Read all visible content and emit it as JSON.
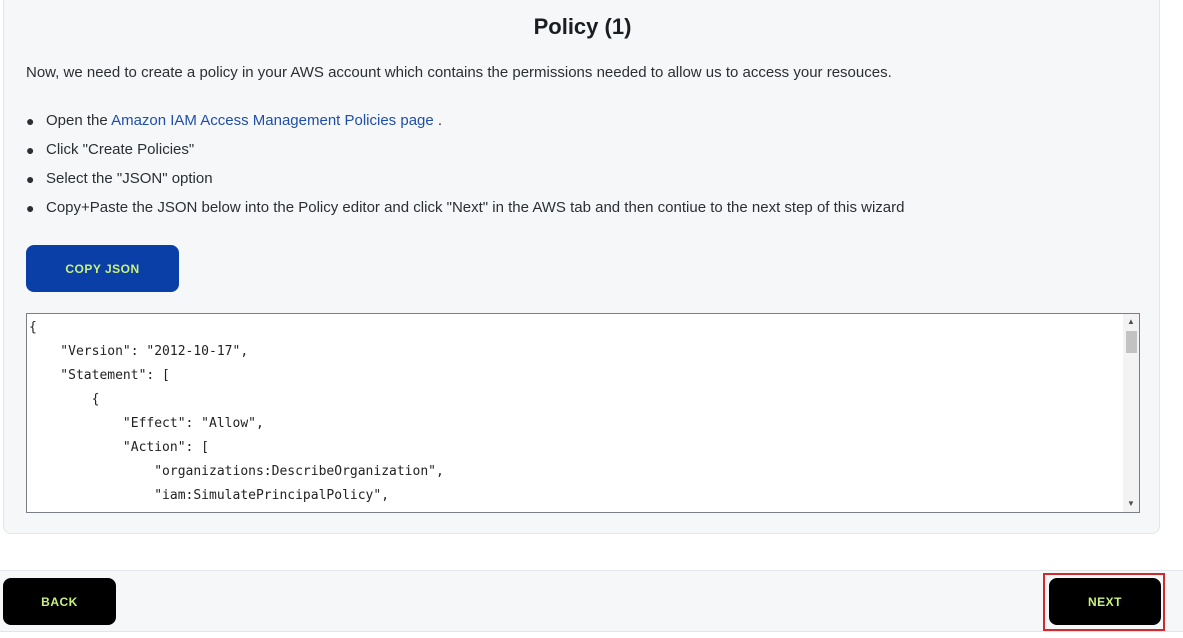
{
  "page": {
    "title": "Policy (1)",
    "intro": "Now, we need to create a policy in your AWS account which contains the permissions needed to allow us to access your resouces."
  },
  "steps": [
    {
      "prefix": "Open the ",
      "link": "Amazon IAM Access Management Policies page",
      "suffix": " ."
    },
    {
      "text": "Click \"Create Policies\""
    },
    {
      "text": "Select the \"JSON\" option"
    },
    {
      "text": "Copy+Paste the JSON below into the Policy editor and click \"Next\" in the AWS tab and then contiue to the next step of this wizard"
    }
  ],
  "copy_button": {
    "label": "COPY JSON"
  },
  "json_editor": {
    "lines": [
      "{",
      "    \"Version\": \"2012-10-17\",",
      "    \"Statement\": [",
      "        {",
      "            \"Effect\": \"Allow\",",
      "            \"Action\": [",
      "                \"organizations:DescribeOrganization\",",
      "                \"iam:SimulatePrincipalPolicy\","
    ]
  },
  "footer": {
    "back_label": "BACK",
    "next_label": "NEXT"
  },
  "colors": {
    "primary_button": "#0b3fa8",
    "button_text": "#c9f27a",
    "link": "#1f4fa8",
    "highlight": "#d22a2a"
  },
  "icons": {
    "scroll_up": "scroll-up-arrow-icon",
    "scroll_down": "scroll-down-arrow-icon"
  }
}
